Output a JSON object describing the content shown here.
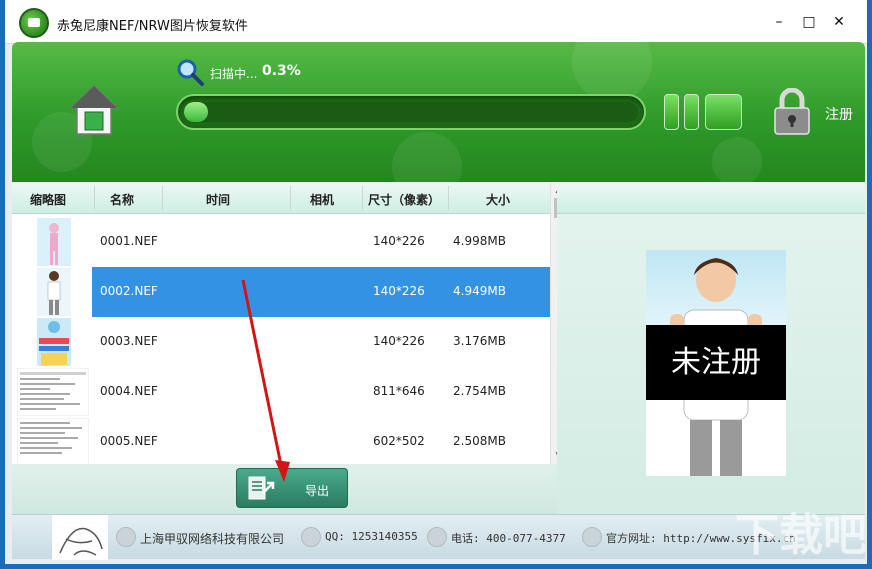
{
  "window": {
    "title": "赤兔尼康NEF/NRW图片恢复软件",
    "minimize_glyph": "–",
    "maximize_glyph": "□",
    "close_glyph": "✕"
  },
  "header": {
    "scan_label": "扫描中...",
    "scan_percent": "0.3%",
    "progress_fraction": 0.003,
    "register_label": "注册",
    "accent_color": "#3aa532"
  },
  "table": {
    "columns": [
      "缩略图",
      "名称",
      "时间",
      "相机",
      "尺寸（像素）",
      "大小"
    ],
    "rows": [
      {
        "name": "0001.NEF",
        "time": "",
        "camera": "",
        "size_px": "140*226",
        "size": "4.998MB",
        "selected": false
      },
      {
        "name": "0002.NEF",
        "time": "",
        "camera": "",
        "size_px": "140*226",
        "size": "4.949MB",
        "selected": true
      },
      {
        "name": "0003.NEF",
        "time": "",
        "camera": "",
        "size_px": "140*226",
        "size": "3.176MB",
        "selected": false
      },
      {
        "name": "0004.NEF",
        "time": "",
        "camera": "",
        "size_px": "811*646",
        "size": "2.754MB",
        "selected": false
      },
      {
        "name": "0005.NEF",
        "time": "",
        "camera": "",
        "size_px": "602*502",
        "size": "2.508MB",
        "selected": false
      }
    ],
    "selection_color": "#3492e4"
  },
  "preview": {
    "banner_text": "未注册"
  },
  "export": {
    "label": "导出"
  },
  "footer": {
    "company": "上海甲驭网络科技有限公司",
    "qq": "QQ: 1253140355",
    "phone": "电话: 400-077-4377",
    "website": "官方网址: http://www.sysfix.cn"
  },
  "icons": {
    "home": "home-icon",
    "search": "search-icon",
    "pause": "pause-icon",
    "stop": "stop-icon",
    "lock": "lock-icon",
    "export": "export-icon"
  }
}
